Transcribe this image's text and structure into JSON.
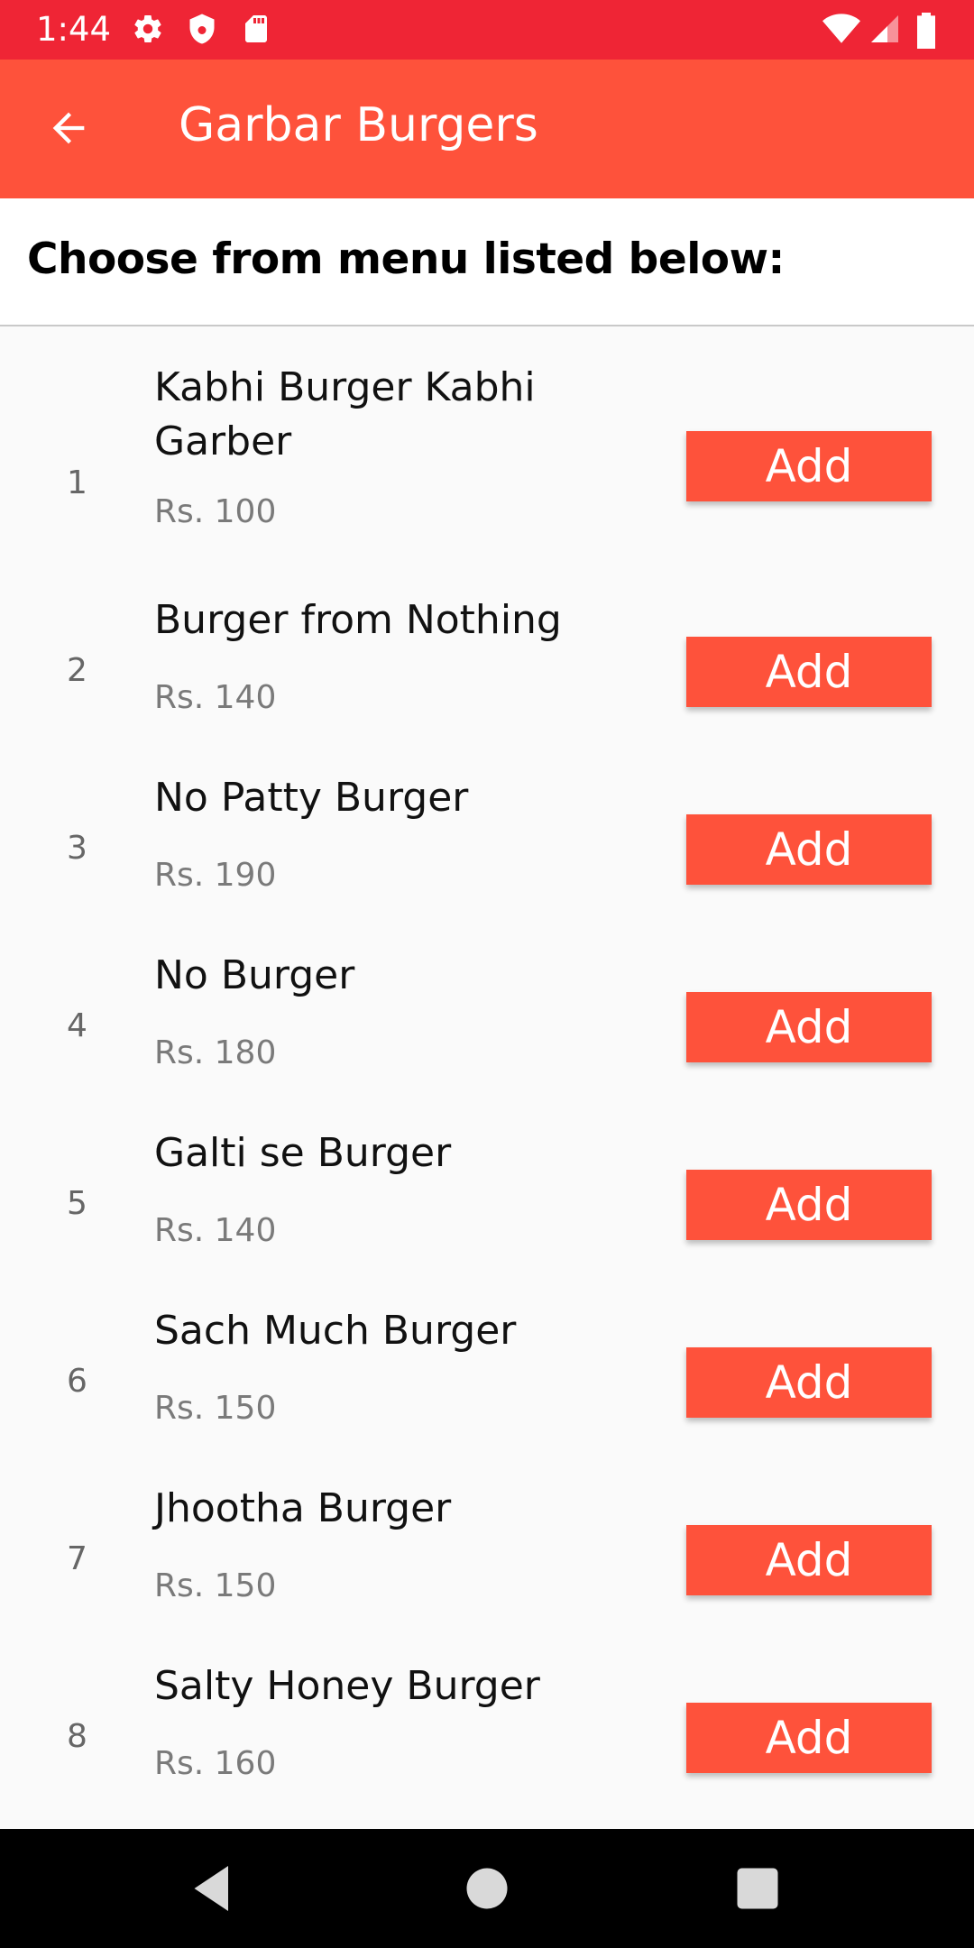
{
  "status_bar": {
    "time": "1:44",
    "icons": [
      "settings-icon",
      "shield-icon",
      "sd-card-icon",
      "wifi-icon",
      "signal-icon",
      "battery-icon"
    ]
  },
  "app_bar": {
    "title": "Garbar Burgers",
    "back_icon": "arrow-back-icon"
  },
  "heading": "Choose from menu listed below:",
  "colors": {
    "status_bar": "#ef2535",
    "app_bar": "#fe523b",
    "button": "#fe523b"
  },
  "menu": [
    {
      "index": "1",
      "name": "Kabhi Burger Kabhi Garber",
      "price": "Rs. 100",
      "button": "Add"
    },
    {
      "index": "2",
      "name": "Burger from Nothing",
      "price": "Rs. 140",
      "button": "Add"
    },
    {
      "index": "3",
      "name": "No Patty Burger",
      "price": "Rs. 190",
      "button": "Add"
    },
    {
      "index": "4",
      "name": "No Burger",
      "price": "Rs. 180",
      "button": "Add"
    },
    {
      "index": "5",
      "name": "Galti se Burger",
      "price": "Rs. 140",
      "button": "Add"
    },
    {
      "index": "6",
      "name": "Sach Much Burger",
      "price": "Rs. 150",
      "button": "Add"
    },
    {
      "index": "7",
      "name": "Jhootha Burger",
      "price": "Rs. 150",
      "button": "Add"
    },
    {
      "index": "8",
      "name": "Salty Honey Burger",
      "price": "Rs. 160",
      "button": "Add"
    }
  ],
  "nav_bar": {
    "icons": [
      "back-triangle-icon",
      "home-circle-icon",
      "recents-square-icon"
    ]
  }
}
